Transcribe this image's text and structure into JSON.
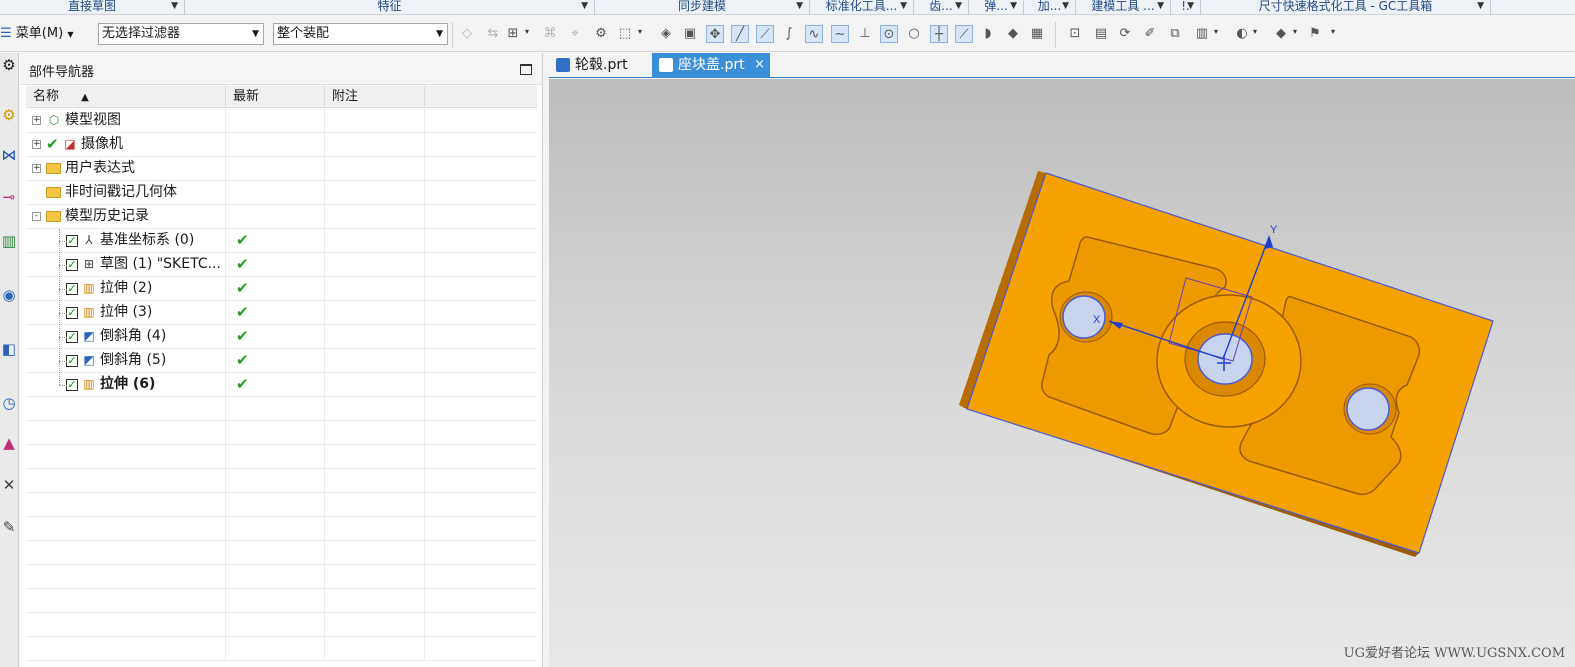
{
  "ribbon_groups": [
    {
      "label": "直接草图",
      "width": 185,
      "center": true,
      "arrow": true
    },
    {
      "label": "特征",
      "width": 410,
      "arrow": true
    },
    {
      "label": "同步建模",
      "width": 215,
      "arrow": true
    },
    {
      "label": "标准化工具...",
      "width": 104,
      "arrow": true
    },
    {
      "label": "齿...",
      "width": 55,
      "arrow": true
    },
    {
      "label": "弹...",
      "width": 55,
      "arrow": true
    },
    {
      "label": "加...",
      "width": 52,
      "arrow": true
    },
    {
      "label": "建模工具 ...",
      "width": 95,
      "arrow": true
    },
    {
      "label": "!.",
      "width": 30,
      "arrow": true
    },
    {
      "label": "尺寸快速格式化工具 - GC工具箱",
      "width": 290,
      "arrow": true
    }
  ],
  "toolbar": {
    "menu_label": "菜单(M)",
    "filter_value": "无选择过滤器",
    "scope_value": "整个装配"
  },
  "navigator": {
    "title": "部件导航器",
    "columns": {
      "name": "名称",
      "latest": "最新",
      "notes": "附注"
    },
    "sort_indicator": "▲",
    "rows": [
      {
        "label": "模型视图",
        "level": 0,
        "expander": "+",
        "icon": "model-views-icon",
        "checked": false,
        "latest": false,
        "bold": false
      },
      {
        "label": "摄像机",
        "level": 0,
        "expander": "+",
        "icon": "camera-icon",
        "checked": false,
        "latest": false,
        "bold": false,
        "tick": true
      },
      {
        "label": "用户表达式",
        "level": 0,
        "expander": "+",
        "icon": "folder-icon",
        "checked": false,
        "latest": false,
        "bold": false
      },
      {
        "label": "非时间戳记几何体",
        "level": 0,
        "expander": "",
        "icon": "folder-icon",
        "checked": false,
        "latest": false,
        "bold": false
      },
      {
        "label": "模型历史记录",
        "level": 0,
        "expander": "-",
        "icon": "folder-open-icon",
        "checked": false,
        "latest": false,
        "bold": false
      },
      {
        "label": "基准坐标系 (0)",
        "level": 1,
        "icon": "datum-csys-icon",
        "checked": true,
        "latest": true,
        "bold": false
      },
      {
        "label": "草图 (1) \"SKETC...",
        "level": 1,
        "icon": "sketch-icon",
        "checked": true,
        "latest": true,
        "bold": false
      },
      {
        "label": "拉伸 (2)",
        "level": 1,
        "icon": "extrude-icon",
        "checked": true,
        "latest": true,
        "bold": false
      },
      {
        "label": "拉伸 (3)",
        "level": 1,
        "icon": "extrude-icon",
        "checked": true,
        "latest": true,
        "bold": false
      },
      {
        "label": "倒斜角 (4)",
        "level": 1,
        "icon": "chamfer-icon",
        "checked": true,
        "latest": true,
        "bold": false
      },
      {
        "label": "倒斜角 (5)",
        "level": 1,
        "icon": "chamfer-icon",
        "checked": true,
        "latest": true,
        "bold": false
      },
      {
        "label": "拉伸 (6)",
        "level": 1,
        "icon": "extrude-icon",
        "checked": true,
        "latest": true,
        "bold": true
      }
    ],
    "empty_rows": 11,
    "latest_mark": "✔",
    "check_mark": "✓"
  },
  "tabs": [
    {
      "label": "轮毂.prt",
      "active": false
    },
    {
      "label": "座块盖.prt",
      "active": true,
      "close": "×"
    }
  ],
  "viewport": {
    "axis_x": "X",
    "axis_y": "Y",
    "part_color": "#f5a100",
    "edge_color": "#4a5bd6"
  },
  "watermark": "UG爱好者论坛 WWW.UGSNX.COM"
}
